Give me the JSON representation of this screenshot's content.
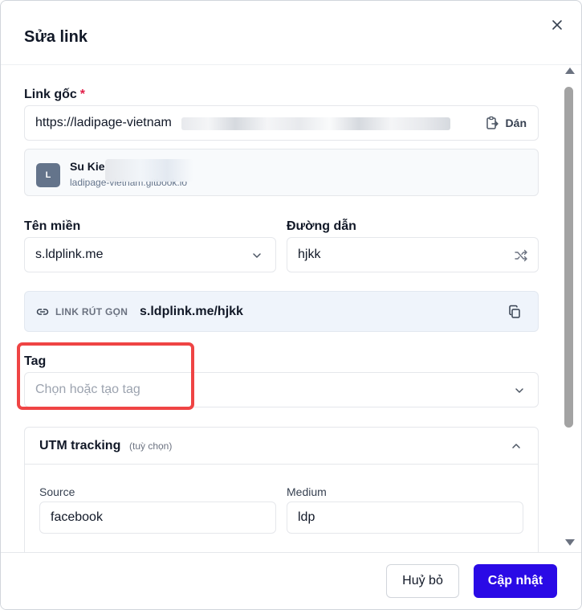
{
  "dialog": {
    "title": "Sửa link",
    "close_icon": "close-icon"
  },
  "original_link": {
    "label": "Link gốc",
    "required_mark": "*",
    "value": "https://ladipage-vietnam",
    "paste_label": "Dán",
    "paste_icon": "clipboard-paste-icon"
  },
  "preview": {
    "avatar_letter": "L",
    "title": "Su Kie",
    "url": "ladipage-vietnam.gitbook.io"
  },
  "domain": {
    "label": "Tên miền",
    "value": "s.ldplink.me",
    "icon": "chevron-down-icon"
  },
  "path": {
    "label": "Đường dẫn",
    "value": "hjkk",
    "icon": "shuffle-icon"
  },
  "short_link": {
    "caption": "LINK RÚT GỌN",
    "value": "s.ldplink.me/hjkk",
    "link_icon": "link-icon",
    "copy_icon": "copy-icon"
  },
  "tag": {
    "label": "Tag",
    "placeholder": "Chọn hoặc tạo tag",
    "highlight_color": "#ef4444"
  },
  "utm": {
    "title": "UTM tracking",
    "optional": "(tuỳ chọn)",
    "toggle_icon": "chevron-up-icon",
    "source_label": "Source",
    "source_value": "facebook",
    "medium_label": "Medium",
    "medium_value": "ldp"
  },
  "footer": {
    "cancel_label": "Huỷ bỏ",
    "update_label": "Cập nhật"
  },
  "colors": {
    "primary": "#2a0ae6",
    "required": "#e11d48",
    "short_link_bg": "#eff4fb"
  }
}
